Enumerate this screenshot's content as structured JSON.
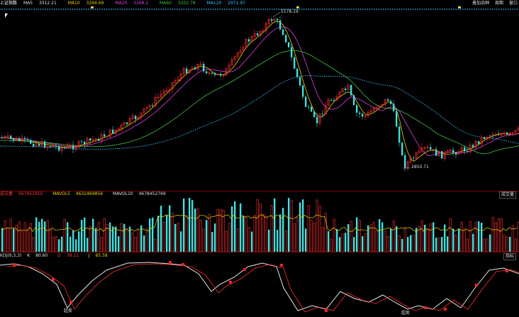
{
  "top_bar": {
    "title": "上证指数",
    "ma_items": [
      {
        "label": "MA5",
        "value": "3312.21",
        "color": "#e0e0e0"
      },
      {
        "label": "MA10",
        "value": "3294.69",
        "color": "#f0d000"
      },
      {
        "label": "MA20",
        "value": "3268.2",
        "color": "#e040e0"
      },
      {
        "label": "MA60",
        "value": "3202.78",
        "color": "#40c040"
      },
      {
        "label": "MA120",
        "value": "2972.97",
        "color": "#40c0ff"
      }
    ],
    "right_buttons": [
      "叠加品种",
      "周期",
      "窗口"
    ]
  },
  "candles": {
    "high_label": "5178.19",
    "low_label": "2850.71"
  },
  "volume_panel": {
    "items": [
      {
        "label": "成交量",
        "value": "567951955",
        "color": "#ff4040"
      },
      {
        "label": "MAVOL5",
        "value": "4632469856",
        "color": "#f0d000"
      },
      {
        "label": "MAVOL10",
        "value": "4678452769",
        "color": "#e0e0e0"
      }
    ],
    "right_button": "成交量"
  },
  "kdj_panel": {
    "items": [
      {
        "label": "KDJ(9,3,3)",
        "value": "",
        "color": "#ddd"
      },
      {
        "label": "K",
        "value": "80.60",
        "color": "#e0e0e0"
      },
      {
        "label": "D",
        "value": "78.11",
        "color": "#ff4040"
      },
      {
        "label": "J",
        "value": "85.58",
        "color": "#f0d000"
      }
    ],
    "right_button": "指标",
    "ann_low1": "超卖",
    "ann_low2": "超卖"
  },
  "colors": {
    "up": "#ff3030",
    "down": "#40e0e0",
    "bg": "#000000",
    "grid": "#7a0000"
  }
}
